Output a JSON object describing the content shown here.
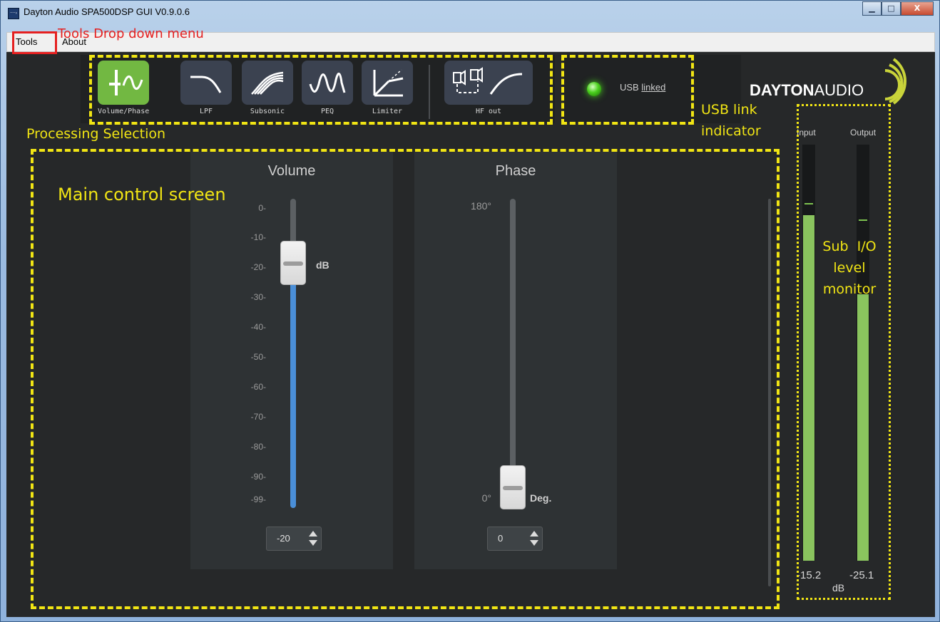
{
  "window": {
    "title": "Dayton Audio SPA500DSP GUI V0.9.0.6",
    "icon_glyph": "····›",
    "minimize_glyph": "▁",
    "maximize_glyph": "□",
    "close_glyph": "X"
  },
  "menu": {
    "tools": "Tools",
    "about": "About"
  },
  "toolbar": {
    "tools": [
      {
        "label": "Volume/Phase",
        "icon": "volume-phase-icon",
        "active": true
      },
      {
        "label": "LPF",
        "icon": "lowpass-curve-icon",
        "active": false
      },
      {
        "label": "Subsonic",
        "icon": "subsonic-curves-icon",
        "active": false
      },
      {
        "label": "PEQ",
        "icon": "peq-wave-icon",
        "active": false
      },
      {
        "label": "Limiter",
        "icon": "limiter-graph-icon",
        "active": false
      },
      {
        "label": "HF out",
        "icon": "hf-out-speakers-icon",
        "active": false
      }
    ]
  },
  "usb": {
    "prefix": "USB ",
    "status": "linked",
    "led_color": "#4ad01e"
  },
  "logo": {
    "bold": "DAYTON",
    "light": "AUDIO"
  },
  "volume": {
    "title": "Volume",
    "ticks": [
      "0-",
      "-10-",
      "-20-",
      "-30-",
      "-40-",
      "-50-",
      "-60-",
      "-70-",
      "-80-",
      "-90-",
      "-99-"
    ],
    "unit": "dB",
    "value": "-20",
    "level_db": -20,
    "range": [
      -99,
      0
    ]
  },
  "phase": {
    "title": "Phase",
    "top_label": "180°",
    "bottom_label": "0°",
    "unit": "Deg.",
    "value": "0",
    "level_deg": 0,
    "range": [
      0,
      180
    ]
  },
  "meters": {
    "input_label": "Input",
    "output_label": "Output",
    "input_value": "-15.2",
    "output_value": "-25.1",
    "unit": "dB",
    "input_level_fraction": 0.83,
    "output_level_fraction": 0.64,
    "input_peak_fraction": 0.86,
    "output_peak_fraction": 0.82
  },
  "annotations": {
    "tools_menu": "Tools Drop down menu",
    "processing": "Processing Selection",
    "main": "Main control screen",
    "usb_line1": "USB link",
    "usb_line2": "indicator",
    "monitor_line1": "Sub  I/O",
    "monitor_line2": "level",
    "monitor_line3": "monitor"
  },
  "colors": {
    "annotation_yellow": "#f1e514",
    "annotation_red": "#e52020",
    "active_tool": "#72b842",
    "volume_fill": "#4a8fd8",
    "meter_fill": "#8ac45e"
  }
}
